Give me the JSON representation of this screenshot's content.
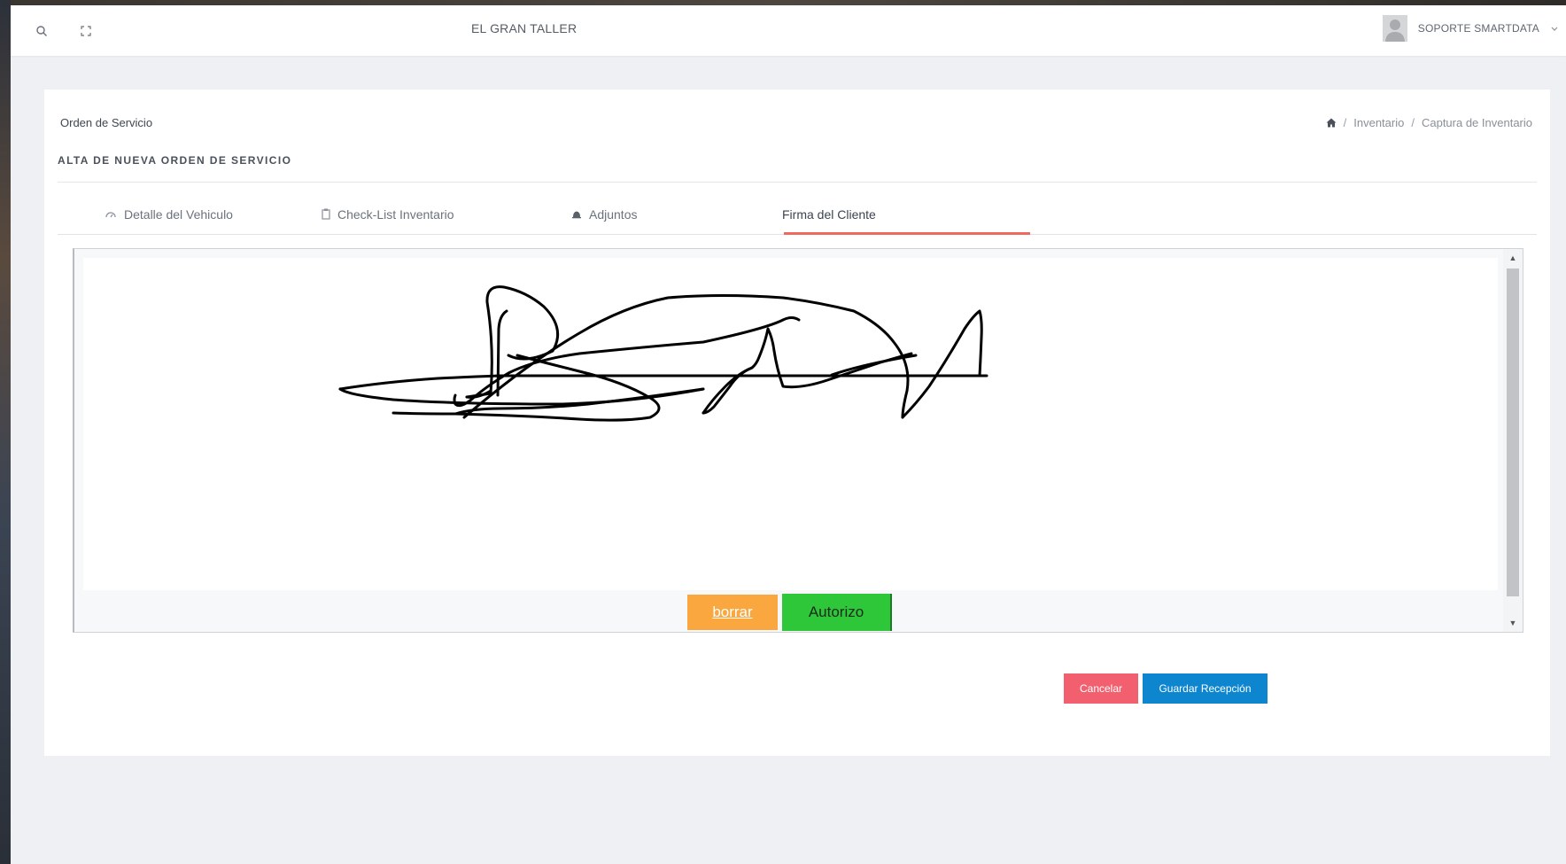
{
  "topbar": {
    "search_icon": "search-icon",
    "fullscreen_icon": "fullscreen-icon",
    "brand": "EL GRAN TALLER",
    "user_name": "SOPORTE SMARTDATA"
  },
  "header": {
    "page_title": "Orden de Servicio",
    "breadcrumb": [
      "Inventario",
      "Captura de Inventario"
    ],
    "section_title": "ALTA DE NUEVA ORDEN DE SERVICIO"
  },
  "tabs": [
    {
      "label": "Detalle del Vehiculo",
      "icon": "gauge-icon"
    },
    {
      "label": "Check-List Inventario",
      "icon": "clipboard-icon"
    },
    {
      "label": "Adjuntos",
      "icon": "bell-icon"
    },
    {
      "label": "Firma del Cliente",
      "icon": ""
    }
  ],
  "active_tab": "Firma del Cliente",
  "signature": {
    "clear_label": "borrar",
    "authorize_label": "Autorizo"
  },
  "actions": {
    "cancel_label": "Cancelar",
    "save_label": "Guardar Recepción"
  },
  "colors": {
    "tab_underline": "#ee6a5f",
    "clear": "#f9a73e",
    "authorize": "#2ec73a",
    "cancel": "#f2606f",
    "save": "#0d86cf"
  }
}
